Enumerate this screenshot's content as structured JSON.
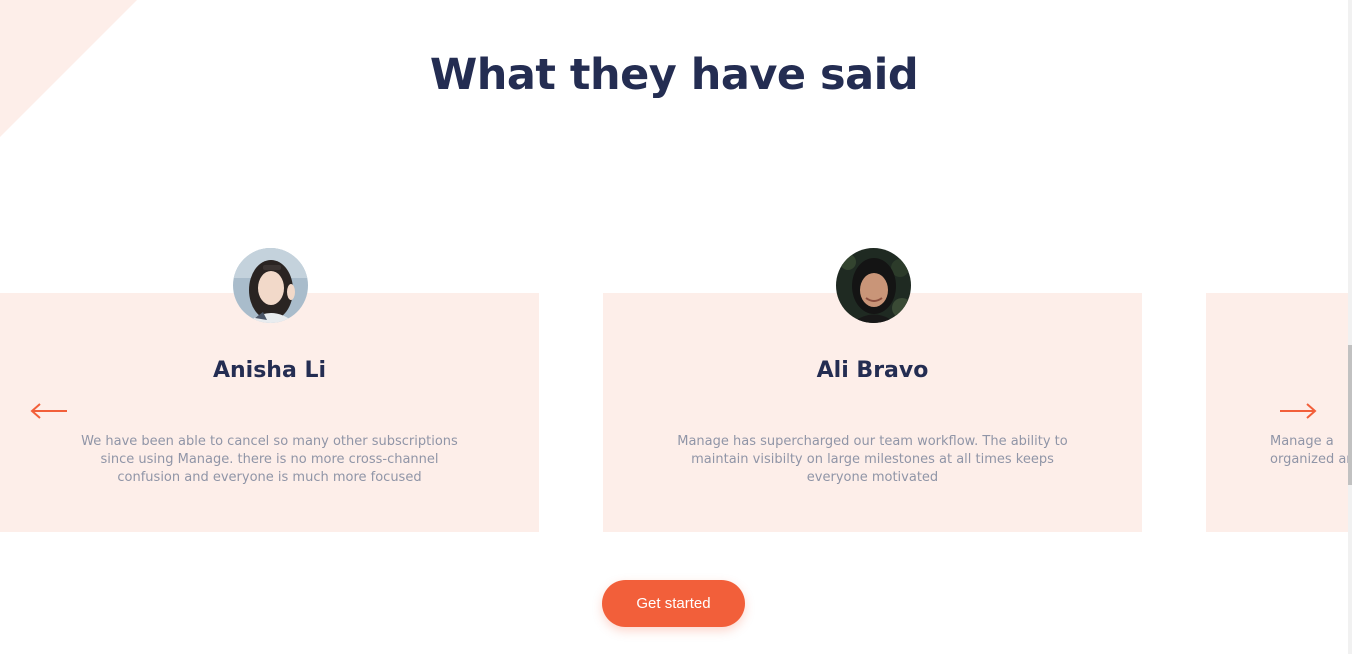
{
  "section": {
    "heading": "What they have said"
  },
  "testimonials": [
    {
      "name": "Anisha Li",
      "quote": "We have been able to cancel so many other subscriptions since using Manage. there is no more cross-channel confusion and everyone is much more focused",
      "avatar_icon": "avatar-anisha-li"
    },
    {
      "name": "Ali Bravo",
      "quote": "Manage has supercharged our team workflow. The ability to maintain visibilty on large milestones at all times keeps everyone motivated",
      "avatar_icon": "avatar-ali-bravo"
    },
    {
      "name": "",
      "quote": "Manage a\norganized an",
      "avatar_icon": ""
    }
  ],
  "nav": {
    "prev_icon": "arrow-left-icon",
    "next_icon": "arrow-right-icon"
  },
  "cta": {
    "label": "Get started"
  },
  "colors": {
    "heading": "#242d52",
    "accent": "#f25f3a",
    "card_bg": "#fdeee9",
    "quote_text": "#9095a7"
  }
}
